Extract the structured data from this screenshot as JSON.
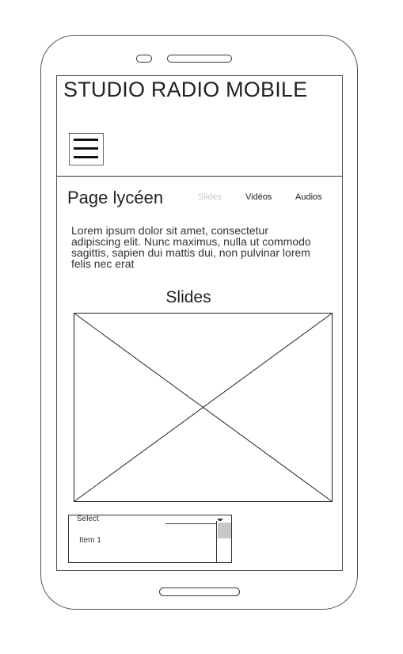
{
  "app": {
    "title": "STUDIO RADIO MOBILE"
  },
  "page": {
    "title": "Page lycéen",
    "tabs": [
      {
        "label": "Slides",
        "active": true
      },
      {
        "label": "Vidéos",
        "active": false
      },
      {
        "label": "Audios",
        "active": false
      }
    ],
    "description": "Lorem ipsum dolor sit amet, consectetur adipiscing elit. Nunc maximus, nulla ut commodo sagittis, sapien dui mattis dui, non pulvinar lorem felis nec erat"
  },
  "section": {
    "title": "Slides",
    "image_icon": "image-placeholder-icon"
  },
  "select": {
    "label": "Select",
    "items": [
      "Item 1"
    ]
  },
  "icons": {
    "menu": "hamburger-icon",
    "dropdown": "chevron-down-icon"
  },
  "colors": {
    "active_tab": "#c9c9c9",
    "text": "#222222",
    "outline": "#333333"
  }
}
